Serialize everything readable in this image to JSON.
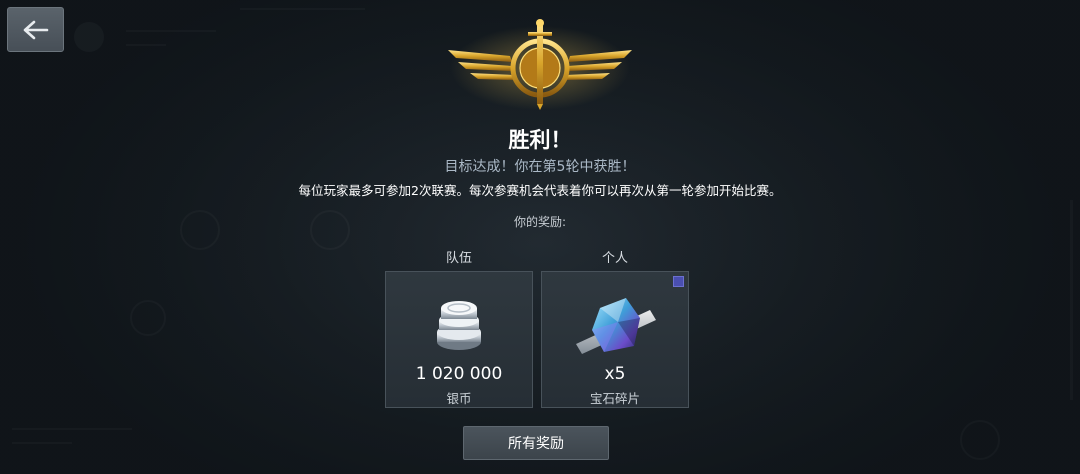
{
  "header": {
    "back_icon": "arrow-left-icon"
  },
  "result": {
    "emblem_icon": "winged-sword-emblem-icon",
    "title": "胜利！",
    "subtitle": "目标达成！你在第5轮中获胜！",
    "info": "每位玩家最多可参加2次联赛。每次参赛机会代表着你可以再次从第一轮参加开始比赛。"
  },
  "rewards": {
    "label": "你的奖励:",
    "team": {
      "column_label": "队伍",
      "icon": "silver-coins-icon",
      "value": "1 020 000",
      "name": "银币"
    },
    "personal": {
      "column_label": "个人",
      "icon": "gem-fragment-icon",
      "value": "x5",
      "name": "宝石碎片"
    }
  },
  "actions": {
    "all_rewards_label": "所有奖励"
  },
  "colors": {
    "background": "#1a2127",
    "accent_gold": "#d9a52b",
    "subtitle": "#aab8c6",
    "card_bg": "#2b343b",
    "badge": "#4a4fb0"
  }
}
